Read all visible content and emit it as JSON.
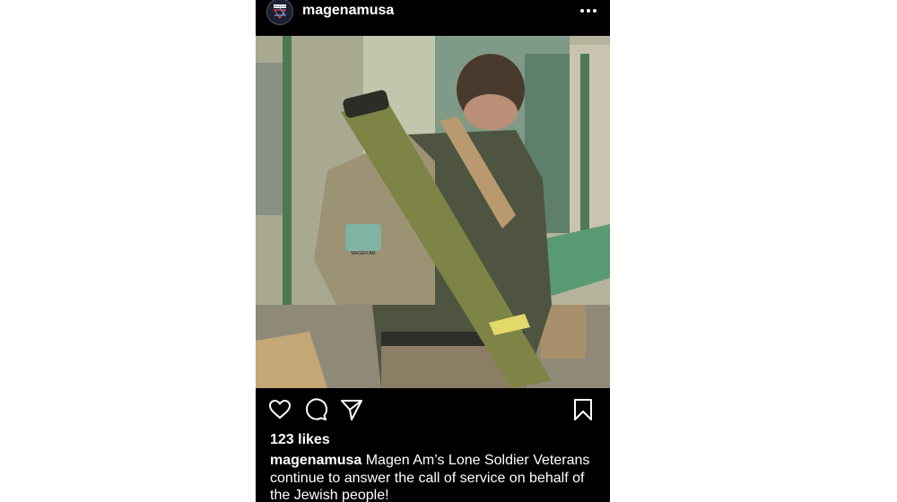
{
  "post": {
    "username": "magenamusa",
    "avatar_text": "MAGEN AM",
    "likes": "123 likes",
    "caption_username": "magenamusa",
    "caption_text": "Magen Am’s Lone Soldier Veterans continue to answer the call of service on behalf of the Jewish people!",
    "image_patch_text": "MAGEN AM"
  },
  "icons": {
    "more": "more-options-icon",
    "like": "heart-icon",
    "comment": "comment-icon",
    "share": "send-icon",
    "save": "bookmark-icon"
  },
  "colors": {
    "background": "#000000",
    "text": "#ffffff",
    "page": "#ffffff"
  }
}
